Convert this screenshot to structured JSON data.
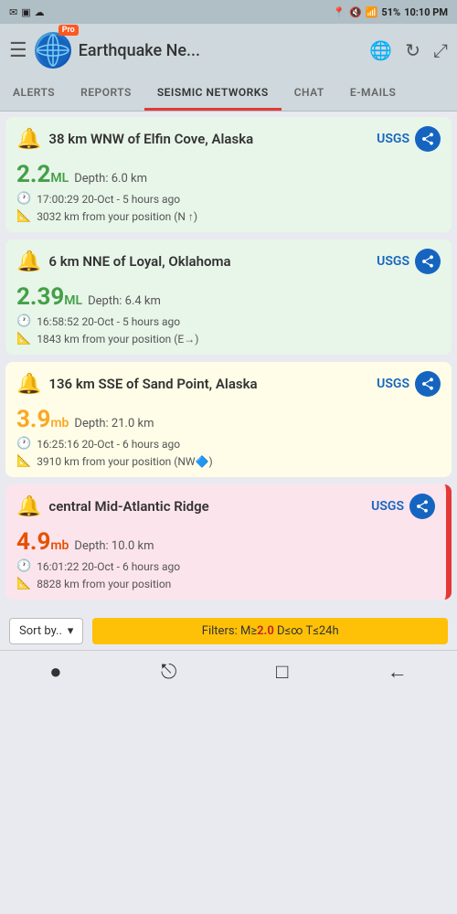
{
  "statusBar": {
    "leftIcons": [
      "✉",
      "▣",
      "☁"
    ],
    "signal": "📶",
    "battery": "51%",
    "time": "10:10 PM"
  },
  "header": {
    "title": "Earthquake Ne...",
    "proBadge": "Pro"
  },
  "tabs": [
    {
      "id": "alerts",
      "label": "ALERTS",
      "active": false
    },
    {
      "id": "reports",
      "label": "REPORTS",
      "active": false
    },
    {
      "id": "seismic",
      "label": "SEISMIC NETWORKS",
      "active": true
    },
    {
      "id": "chat",
      "label": "CHAT",
      "active": false
    },
    {
      "id": "emails",
      "label": "E-MAILS",
      "active": false
    }
  ],
  "earthquakes": [
    {
      "id": "eq1",
      "location": "38 km WNW of Elfin Cove, Alaska",
      "source": "USGS",
      "magnitude": "2.2",
      "magType": "ML",
      "depth": "Depth: 6.0 km",
      "time": "17:00:29 20-Oct - 5 hours ago",
      "distance": "3032 km from your position (N ↑)",
      "cardColor": "green",
      "magColor": "green"
    },
    {
      "id": "eq2",
      "location": "6 km NNE of Loyal, Oklahoma",
      "source": "USGS",
      "magnitude": "2.39",
      "magType": "ML",
      "depth": "Depth: 6.4 km",
      "time": "16:58:52 20-Oct - 5 hours ago",
      "distance": "1843 km from your position (E→)",
      "cardColor": "green",
      "magColor": "green"
    },
    {
      "id": "eq3",
      "location": "136 km SSE of Sand Point, Alaska",
      "source": "USGS",
      "magnitude": "3.9",
      "magType": "mb",
      "depth": "Depth: 21.0 km",
      "time": "16:25:16 20-Oct - 6 hours ago",
      "distance": "3910 km from your position (NW🔷)",
      "cardColor": "yellow",
      "magColor": "yellow"
    },
    {
      "id": "eq4",
      "location": "central Mid-Atlantic Ridge",
      "source": "USGS",
      "magnitude": "4.9",
      "magType": "mb",
      "depth": "Depth: 10.0 km",
      "time": "16:01:22 20-Oct - 6 hours ago",
      "distance": "8828 km from your position",
      "cardColor": "red",
      "magColor": "orange"
    }
  ],
  "bottomBar": {
    "sortLabel": "Sort by..",
    "filterText": "Filters: M≥",
    "filterMag": "2.0",
    "filterRest": " D≤∞ T≤24h"
  },
  "navBar": {
    "icons": [
      "●",
      "⎋",
      "□",
      "←"
    ]
  }
}
